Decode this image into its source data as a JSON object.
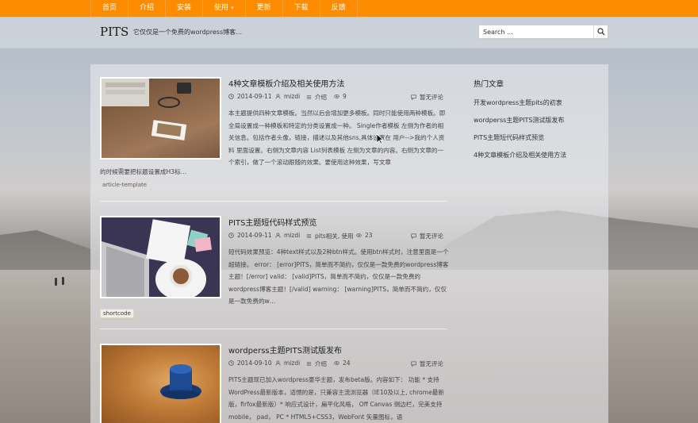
{
  "nav": {
    "items": [
      "首页",
      "介绍",
      "安装",
      "使用",
      "更新",
      "下载",
      "反馈"
    ],
    "dropdown_caret": "▾"
  },
  "header": {
    "site_title": "PITS",
    "site_description": "它仅仅是一个免费的wordpress博客…",
    "search_placeholder": "Search …"
  },
  "posts": [
    {
      "title": "4种文章模板介绍及相关使用方法",
      "date": "2014-09-11",
      "author": "mizdi",
      "category": "介绍",
      "views": "9",
      "comments": "暂无评论",
      "excerpt": "本主题提供四种文章模板。当然以后会增加更多模板。同时只能使用两种模板。即全局设置成一种模板和特定的分类设置成一种。 Single作者模板 左侧为作者的相关信息。包括作者头像，链接，描述以及其他sns,具体设置在 用户-->我的个人资料 里面设置。右侧为文章内容 List列表模板 左侧为文章的内容。右侧为文章的一个索引，做了一个滚动跟随的效果。要使用这种效果，写文章",
      "excerpt_tail": "的时候需要把标题设置成H3标…",
      "tag": "article-template"
    },
    {
      "title": "PITS主题短代码样式预览",
      "date": "2014-09-11",
      "author": "mizdi",
      "category": "pits相关, 使用",
      "views": "23",
      "comments": "暂无评论",
      "excerpt": "短代码效果预览：4种text样式以及2种btn样式。使用btn样式时，注意里面是一个超链接。 error： [error]PITS，简单而不简约，仅仅是一款免费的wordpress博客主题！[/error] valid： [valid]PITS，简单而不简约，仅仅是一款免费的wordpress博客主题！[/valid] warning： [warning]PITS，简单而不简约，仅仅是一款免费的w…",
      "tag": "shortcode"
    },
    {
      "title": "wordperss主题PITS测试版发布",
      "date": "2014-09-10",
      "author": "mizdi",
      "category": "介绍",
      "views": "24",
      "comments": "暂无评论",
      "excerpt": "PITS主题现已加入wordpress豪华主题，发布beta版。内容如下： 功能 * 支持WordPress最新版本，适惯的是，只兼容主流浏览器（IE10及以上, chrome最新版，firfox最新版）* 响应式设计，扁平化风格， Off Canvas 侧边栏，完美支持mobile， pad， PC * HTML5+CSS3，WebFont 矢量图标，语"
    }
  ],
  "sidebar": {
    "title": "热门文章",
    "links": [
      "开发wordpress主题pits的初衷",
      "wordperss主题PITS测试版发布",
      "PITS主题短代码样式预览",
      "4种文章模板介绍及相关使用方法"
    ]
  },
  "colors": {
    "nav_bg": "#ff8c00",
    "text": "#222222"
  },
  "icons": [
    "clock-icon",
    "user-icon",
    "list-icon",
    "eye-icon",
    "comment-icon",
    "search-icon",
    "mouse-cursor-icon"
  ]
}
